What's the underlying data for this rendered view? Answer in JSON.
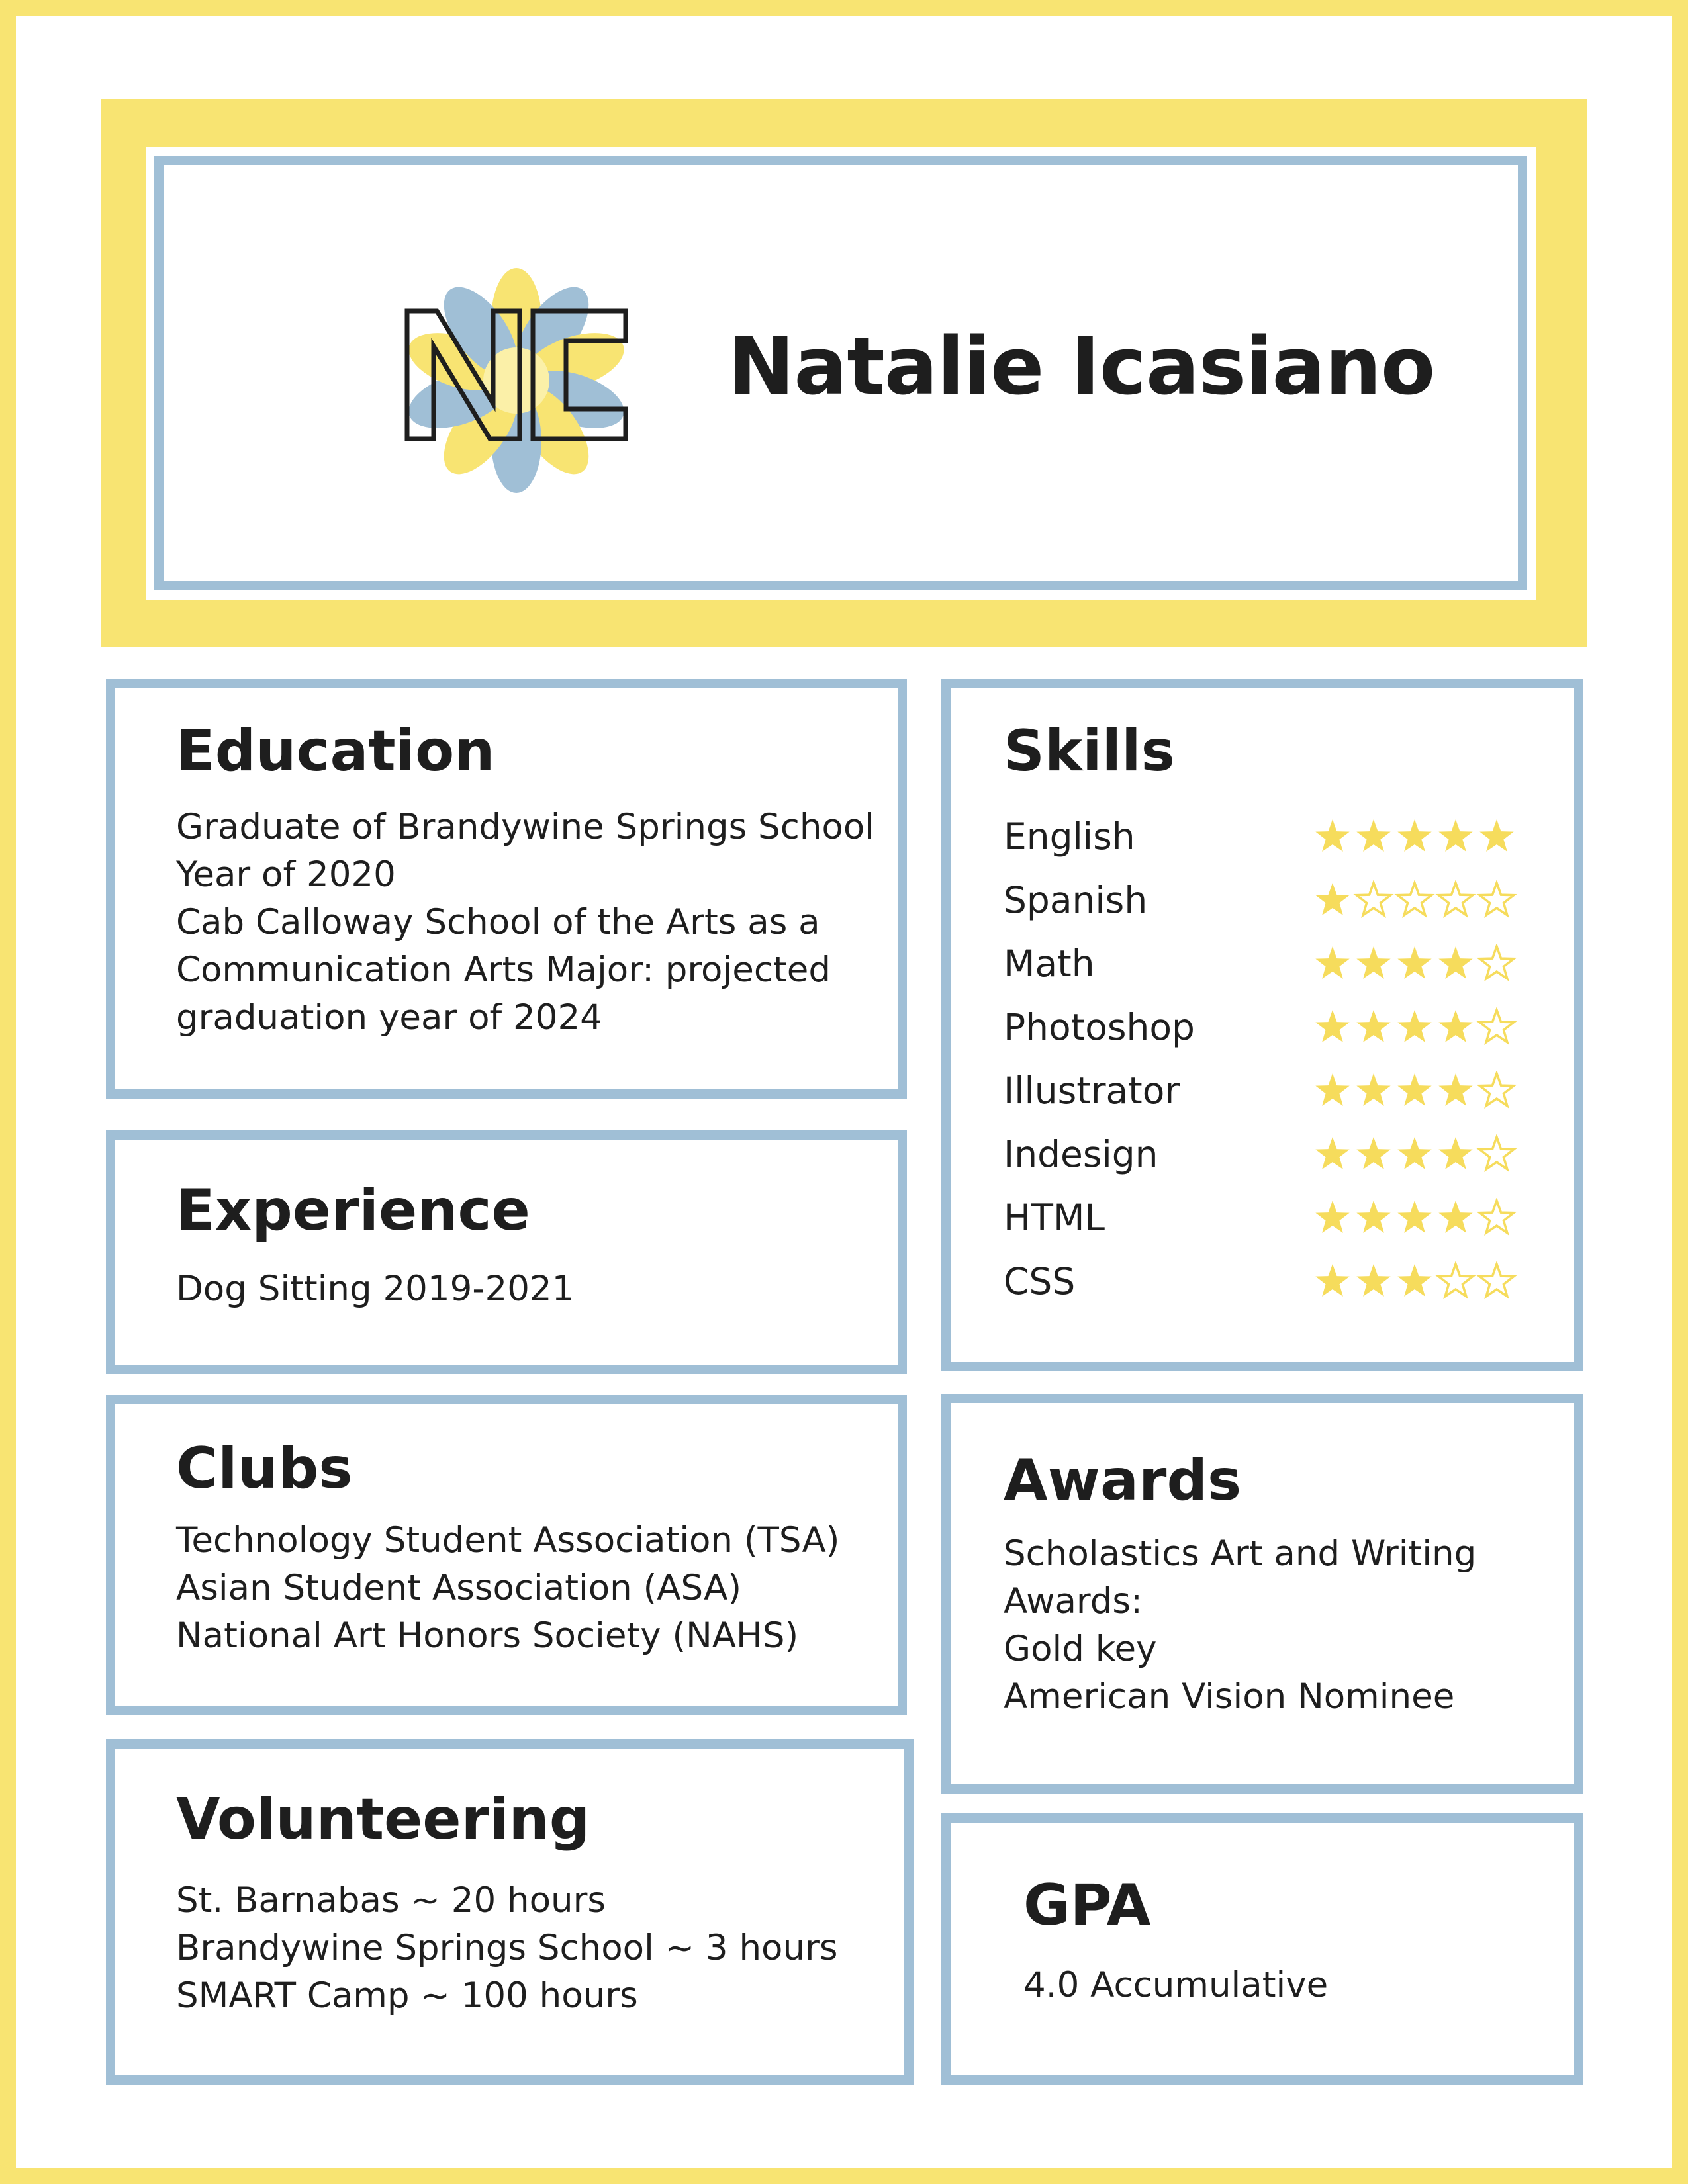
{
  "colors": {
    "accent_yellow": "#f8e472",
    "accent_blue": "#a0bfd6",
    "star_yellow": "#f6dc5c",
    "text": "#1e1e1e"
  },
  "header": {
    "name": "Natalie Icasiano",
    "logo_icon": "flower-monogram-icon"
  },
  "education": {
    "title": "Education",
    "lines": [
      "Graduate of Brandywine Springs School",
      "Year of 2020",
      "Cab Calloway School of the Arts as a",
      "Communication Arts Major: projected",
      "graduation year of 2024"
    ]
  },
  "experience": {
    "title": "Experience",
    "lines": [
      "Dog Sitting 2019-2021"
    ]
  },
  "clubs": {
    "title": "Clubs",
    "lines": [
      "Technology Student Association (TSA)",
      "Asian Student Association (ASA)",
      "National Art Honors Society (NAHS)"
    ]
  },
  "volunteering": {
    "title": "Volunteering",
    "lines": [
      "St. Barnabas ~ 20 hours",
      "Brandywine Springs School ~ 3 hours",
      "SMART Camp ~ 100 hours"
    ]
  },
  "skills": {
    "title": "Skills",
    "max_stars": 5,
    "items": [
      {
        "name": "English",
        "rating": 5
      },
      {
        "name": "Spanish",
        "rating": 1
      },
      {
        "name": "Math",
        "rating": 4
      },
      {
        "name": "Photoshop",
        "rating": 4
      },
      {
        "name": "Illustrator",
        "rating": 4
      },
      {
        "name": "Indesign",
        "rating": 4
      },
      {
        "name": "HTML",
        "rating": 4
      },
      {
        "name": "CSS",
        "rating": 3
      }
    ]
  },
  "awards": {
    "title": "Awards",
    "lines": [
      "Scholastics Art and Writing",
      "Awards:",
      "Gold key",
      "American Vision Nominee"
    ]
  },
  "gpa": {
    "title": "GPA",
    "lines": [
      "4.0 Accumulative"
    ]
  }
}
